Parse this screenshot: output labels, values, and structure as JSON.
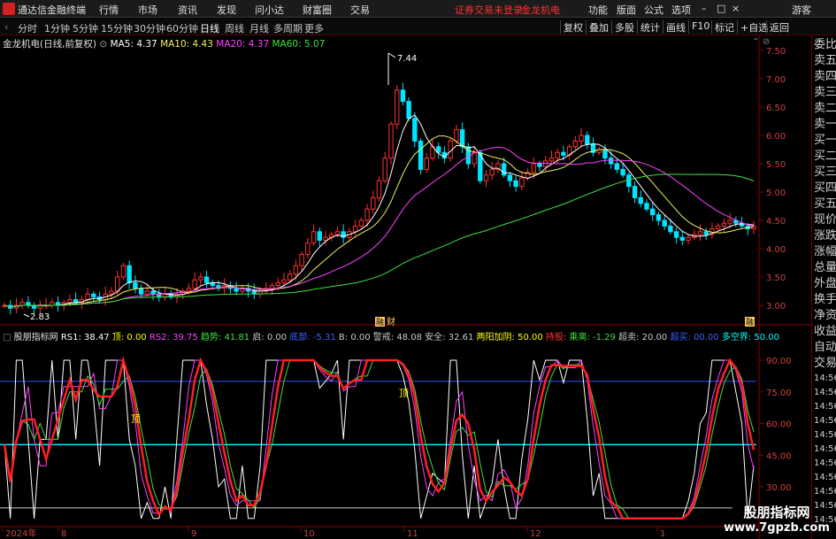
{
  "app": {
    "title": "通达信金融终端",
    "menu": [
      "行情",
      "市场",
      "资讯",
      "发现",
      "问小达",
      "财富圈",
      "交易"
    ],
    "notice": "证券交易未登录",
    "stock_name_header": "金龙机电",
    "right_menu": [
      "功能",
      "版面",
      "公式",
      "选项"
    ],
    "guest": "游客",
    "window_controls": [
      "–",
      "□",
      "×"
    ]
  },
  "period_bar": {
    "items": [
      "分时",
      "1分钟",
      "5分钟",
      "15分钟",
      "30分钟",
      "60分钟",
      "日线",
      "周线",
      "月线",
      "多周期",
      "更多"
    ],
    "active": "日线",
    "tools": [
      "复权",
      "叠加",
      "多股",
      "统计",
      "画线",
      "F10",
      "标记",
      "+自选",
      "返回"
    ]
  },
  "main_chart": {
    "stock_label": "金龙机电(日线,前复权)",
    "ma": [
      {
        "label": "MA5: 4.37",
        "color": "#ffffff"
      },
      {
        "label": "MA10: 4.43",
        "color": "#f0f060"
      },
      {
        "label": "MA20: 4.37",
        "color": "#ff40ff"
      },
      {
        "label": "MA60: 5.07",
        "color": "#40e040"
      }
    ],
    "high_label": "7.44",
    "low_label": "2.83",
    "price_axis": [
      "7.50",
      "7.00",
      "6.50",
      "6.00",
      "5.50",
      "5.00",
      "4.50",
      "4.00",
      "3.50",
      "3.00"
    ],
    "markers": [
      "融",
      "财",
      "融"
    ]
  },
  "indicator": {
    "name": "股朋指标网",
    "values": [
      {
        "label": "RS1: 38.47",
        "color": "#ffffff"
      },
      {
        "label": "顶: 0.00",
        "color": "#ffff00"
      },
      {
        "label": "RS2: 39.75",
        "color": "#ff40ff"
      },
      {
        "label": "趋势: 41.81",
        "color": "#40e040"
      },
      {
        "label": "启: 0.00",
        "color": "#c8c8c8"
      },
      {
        "label": "底部: -5.31",
        "color": "#4060ff"
      },
      {
        "label": "B: 0.00",
        "color": "#c8c8c8"
      },
      {
        "label": "警戒: 48.08",
        "color": "#c8c8c8"
      },
      {
        "label": "安全: 32.61",
        "color": "#c8c8c8"
      },
      {
        "label": "两阳加阴: 50.00",
        "color": "#ffff00"
      },
      {
        "label": "持股: ",
        "color": "#ff3030"
      },
      {
        "label": "乘离: -1.29",
        "color": "#40e040"
      },
      {
        "label": "超卖: 20.00",
        "color": "#c8c8c8"
      },
      {
        "label": "超买: 00.00",
        "color": "#4060ff"
      },
      {
        "label": "多空界: 50.00",
        "color": "#00ffff"
      }
    ],
    "axis": [
      "90.00",
      "75.00",
      "60.00",
      "45.00",
      "30.00"
    ],
    "top_marker": "顶",
    "marker2": "顶"
  },
  "time_axis": [
    "2024年",
    "8",
    "9",
    "10",
    "11",
    "12",
    "1"
  ],
  "right_panel": {
    "top": [
      "委比",
      "卖五",
      "卖四",
      "卖三",
      "卖二",
      "卖一",
      "买一",
      "买二",
      "买三",
      "买四",
      "买五",
      "现价",
      "涨跌",
      "涨幅",
      "总量",
      "外盘",
      "换手",
      "净资",
      "收益"
    ],
    "bottom": [
      "自动",
      "交易"
    ],
    "times": [
      "14:56",
      "14:56",
      "14:56",
      "14:56",
      "14:56",
      "14:56",
      "14:56",
      "14:56",
      "14:56",
      "14:56",
      "14:56"
    ]
  },
  "watermark": {
    "line1": "股朋指标网",
    "line2": "www.7gpzb.com"
  },
  "colors": {
    "up": "#ff3030",
    "down": "#00e5ff",
    "bg": "#000000",
    "frame": "#8b0000"
  }
}
